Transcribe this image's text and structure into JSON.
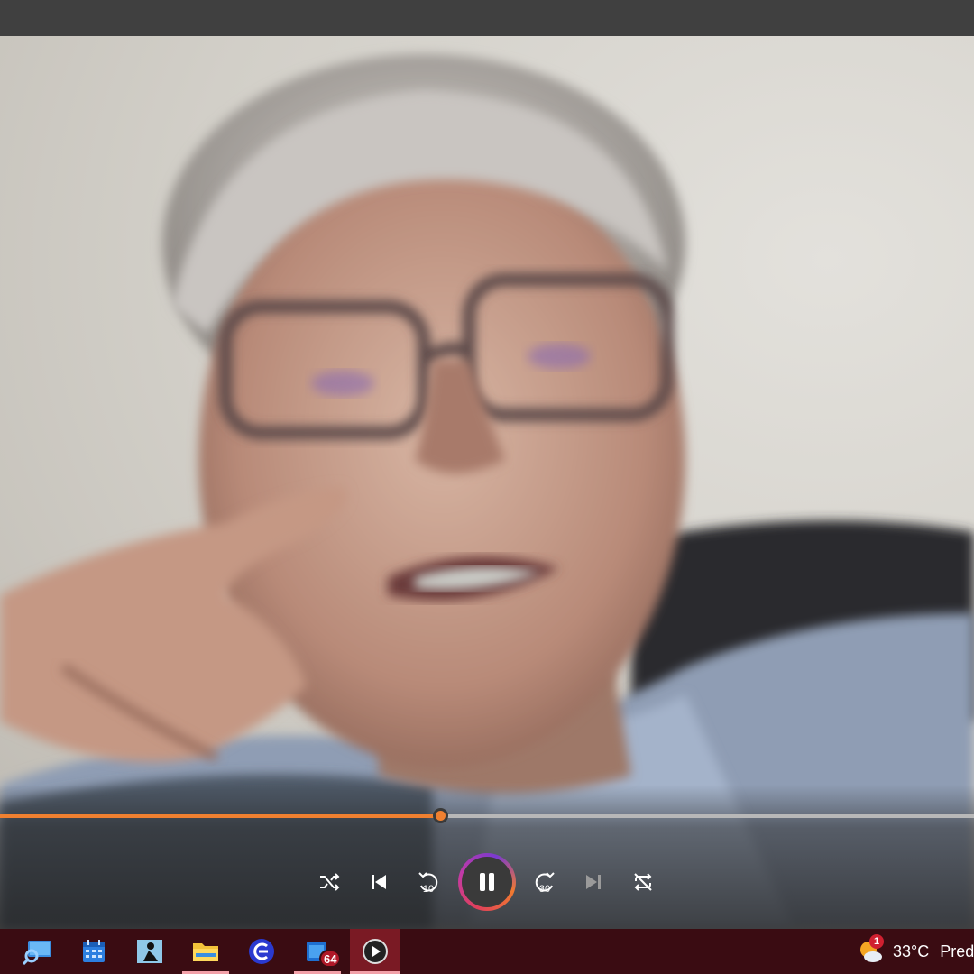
{
  "player": {
    "progress_fraction": 0.452,
    "accent_color": "#f08030",
    "controls": [
      {
        "name": "shuffle-button",
        "icon": "shuffle-icon"
      },
      {
        "name": "previous-button",
        "icon": "skip-previous-icon"
      },
      {
        "name": "rewind-button",
        "icon": "rewind-10-icon",
        "label": "10"
      },
      {
        "name": "pause-button",
        "icon": "pause-icon"
      },
      {
        "name": "forward-button",
        "icon": "forward-30-icon",
        "label": "30"
      },
      {
        "name": "next-button",
        "icon": "skip-next-icon"
      },
      {
        "name": "repeat-button",
        "icon": "repeat-icon"
      }
    ]
  },
  "taskbar": {
    "apps": [
      {
        "name": "search",
        "icon": "search-monitor-icon"
      },
      {
        "name": "calendar",
        "icon": "calendar-icon"
      },
      {
        "name": "reader",
        "icon": "reader-icon"
      },
      {
        "name": "file-explorer",
        "icon": "folder-icon"
      },
      {
        "name": "browser",
        "icon": "browser-icon"
      },
      {
        "name": "store",
        "icon": "store-icon",
        "badge": "64"
      },
      {
        "name": "media-player",
        "icon": "media-player-icon"
      }
    ],
    "weather": {
      "badge": "1",
      "temperature": "33°C",
      "text": "Pred"
    }
  }
}
